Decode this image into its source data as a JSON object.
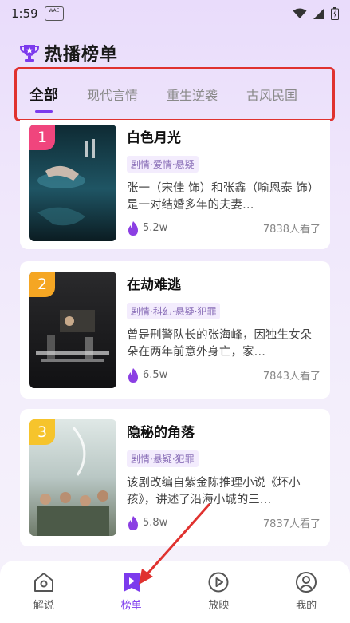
{
  "status": {
    "time": "1:59",
    "badge": "WAE"
  },
  "header": {
    "title": "热播榜单"
  },
  "tabs": [
    {
      "label": "全部"
    },
    {
      "label": "现代言情"
    },
    {
      "label": "重生逆袭"
    },
    {
      "label": "古风民国"
    }
  ],
  "dramas": [
    {
      "rank": "1",
      "title": "白色月光",
      "genres": "剧情·爱情·悬疑",
      "desc": "张一（宋佳 饰）和张鑫（喻恩泰 饰）是一对结婚多年的夫妻…",
      "heat": "5.2w",
      "views": "7838人看了",
      "poster_title": "白色月光"
    },
    {
      "rank": "2",
      "title": "在劫难逃",
      "genres": "剧情·科幻·悬疑·犯罪",
      "desc": "曾是刑警队长的张海峰，因独生女朵朵在两年前意外身亡，家…",
      "heat": "6.5w",
      "views": "7843人看了",
      "poster_title": "在劫难逃"
    },
    {
      "rank": "3",
      "title": "隐秘的角落",
      "genres": "剧情·悬疑·犯罪",
      "desc": "该剧改编自紫金陈推理小说《坏小孩》，讲述了沿海小城的三…",
      "heat": "5.8w",
      "views": "7837人看了",
      "poster_title": "隐秘的角落"
    }
  ],
  "nav": [
    {
      "label": "解说",
      "icon": "home-icon"
    },
    {
      "label": "榜单",
      "icon": "ranking-icon"
    },
    {
      "label": "放映",
      "icon": "play-icon"
    },
    {
      "label": "我的",
      "icon": "profile-icon"
    }
  ],
  "colors": {
    "accent": "#7c3aed",
    "rank1": "#f0457d",
    "rank2": "#f5a623",
    "rank3": "#f6c42c",
    "highlight": "#e0322f"
  }
}
